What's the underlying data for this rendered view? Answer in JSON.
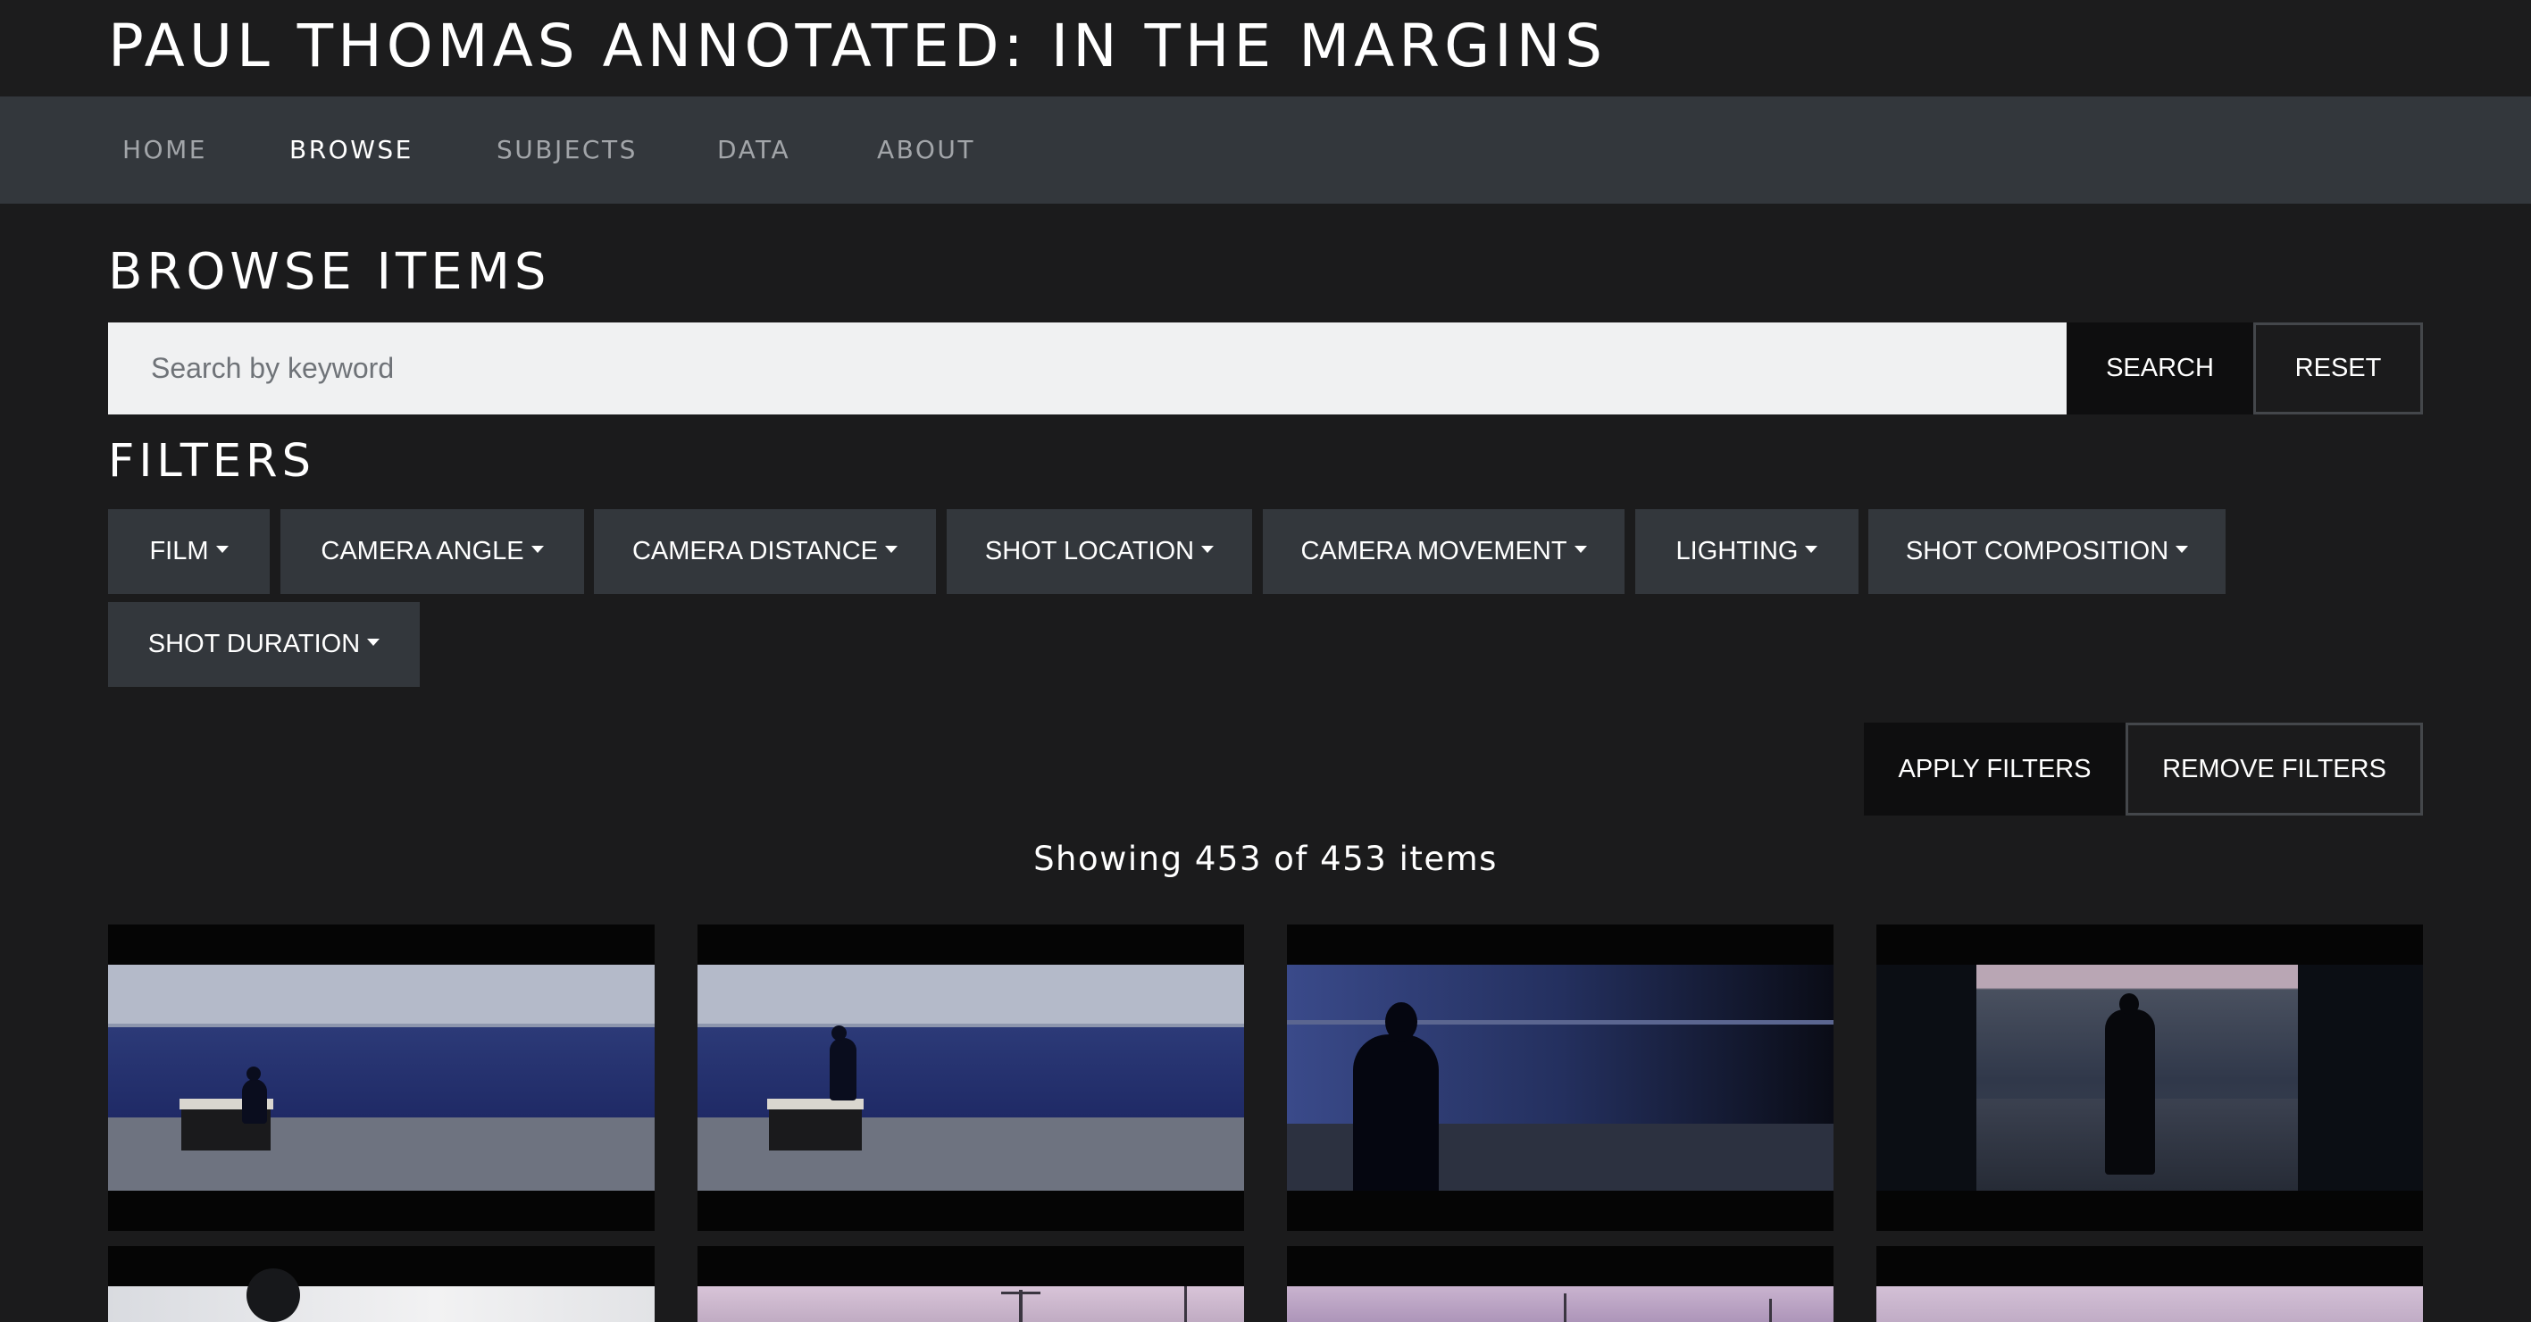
{
  "site": {
    "title": "PAUL THOMAS ANNOTATED: IN THE MARGINS"
  },
  "nav": {
    "items": [
      {
        "label": "HOME",
        "active": false
      },
      {
        "label": "BROWSE",
        "active": true
      },
      {
        "label": "SUBJECTS",
        "active": false
      },
      {
        "label": "DATA",
        "active": false
      },
      {
        "label": "ABOUT",
        "active": false
      }
    ]
  },
  "browse": {
    "heading": "BROWSE ITEMS",
    "search": {
      "placeholder": "Search by keyword",
      "value": "",
      "search_label": "SEARCH",
      "reset_label": "RESET"
    }
  },
  "filters": {
    "heading": "FILTERS",
    "dropdowns": [
      {
        "label": "FILM"
      },
      {
        "label": "CAMERA ANGLE"
      },
      {
        "label": "CAMERA DISTANCE"
      },
      {
        "label": "SHOT LOCATION"
      },
      {
        "label": "CAMERA MOVEMENT"
      },
      {
        "label": "LIGHTING"
      },
      {
        "label": "SHOT COMPOSITION"
      },
      {
        "label": "SHOT DURATION"
      }
    ],
    "apply_label": "APPLY FILTERS",
    "remove_label": "REMOVE FILTERS"
  },
  "results": {
    "count_text": "Showing 453 of 453 items"
  },
  "colors": {
    "page_background": "#1b1b1c",
    "navbar_background": "#33373c",
    "filter_button_background": "#33373c",
    "dark_button_background": "#0e0e0f",
    "search_background": "#f0f1f2"
  }
}
